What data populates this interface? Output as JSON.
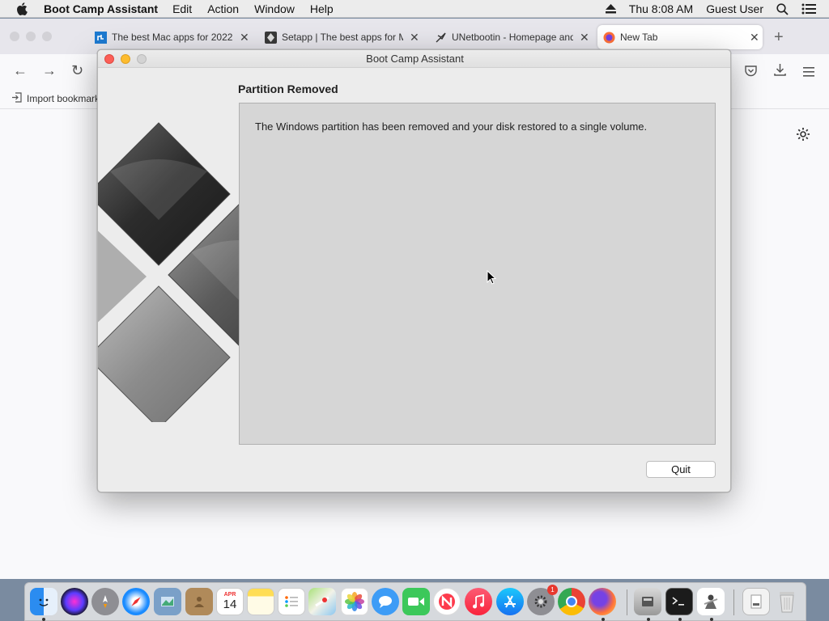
{
  "menubar": {
    "app_name": "Boot Camp Assistant",
    "items": [
      "Edit",
      "Action",
      "Window",
      "Help"
    ],
    "clock": "Thu 8:08 AM",
    "user": "Guest User"
  },
  "browser": {
    "tabs": [
      {
        "label": "The best Mac apps for 2022",
        "close": "✕"
      },
      {
        "label": "Setapp | The best apps for M",
        "close": "✕"
      },
      {
        "label": "UNetbootin - Homepage and",
        "close": "✕"
      },
      {
        "label": "New Tab",
        "close": "✕"
      }
    ],
    "new_tab": "+",
    "bookmark_import": "Import bookmark"
  },
  "dialog": {
    "title": "Boot Camp Assistant",
    "heading": "Partition Removed",
    "message": "The Windows partition has been removed and your disk restored to a single volume.",
    "quit_label": "Quit"
  },
  "dock": {
    "calendar": {
      "month": "APR",
      "day": "14"
    },
    "system_prefs_badge": "1"
  }
}
